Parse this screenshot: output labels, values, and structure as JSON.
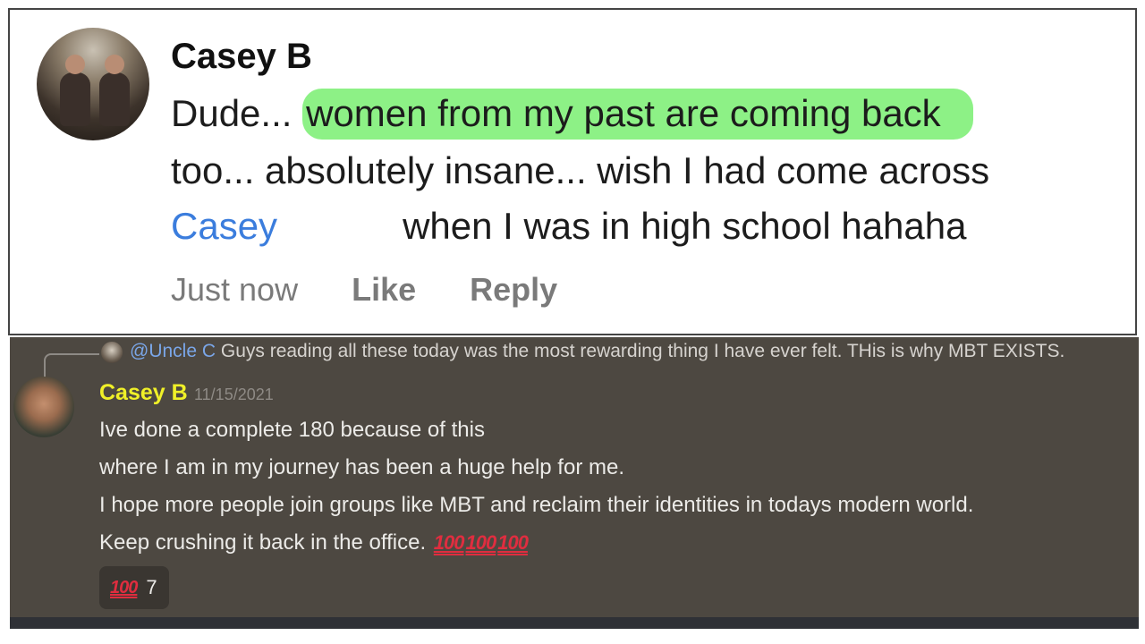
{
  "comment": {
    "author": "Casey B",
    "text_before": "Dude... ",
    "highlighted": "women from my past are coming back",
    "line2": "too... absolutely insane... wish I had come across",
    "mention": "Casey",
    "line3_after": "when I was in high school hahaha",
    "timestamp": "Just now",
    "like_label": "Like",
    "reply_label": "Reply",
    "highlight_color": "#8df186",
    "link_color": "#3b7ddd"
  },
  "discord": {
    "reply": {
      "mention": "@Uncle C",
      "text": "Guys reading all these today was the most rewarding thing I have ever felt. THis is why MBT EXISTS."
    },
    "author": "Casey B",
    "author_color": "#f0f028",
    "timestamp": "11/15/2021",
    "lines": [
      "Ive done a complete 180 because of this",
      "where I am in my journey has been a huge help for me.",
      "I hope more people join groups like MBT and reclaim their identities in todays modern world.",
      "Keep crushing it back in the office."
    ],
    "emoji_text": "100",
    "emoji_icon": "hundred-points-icon",
    "reaction_count": "7"
  }
}
